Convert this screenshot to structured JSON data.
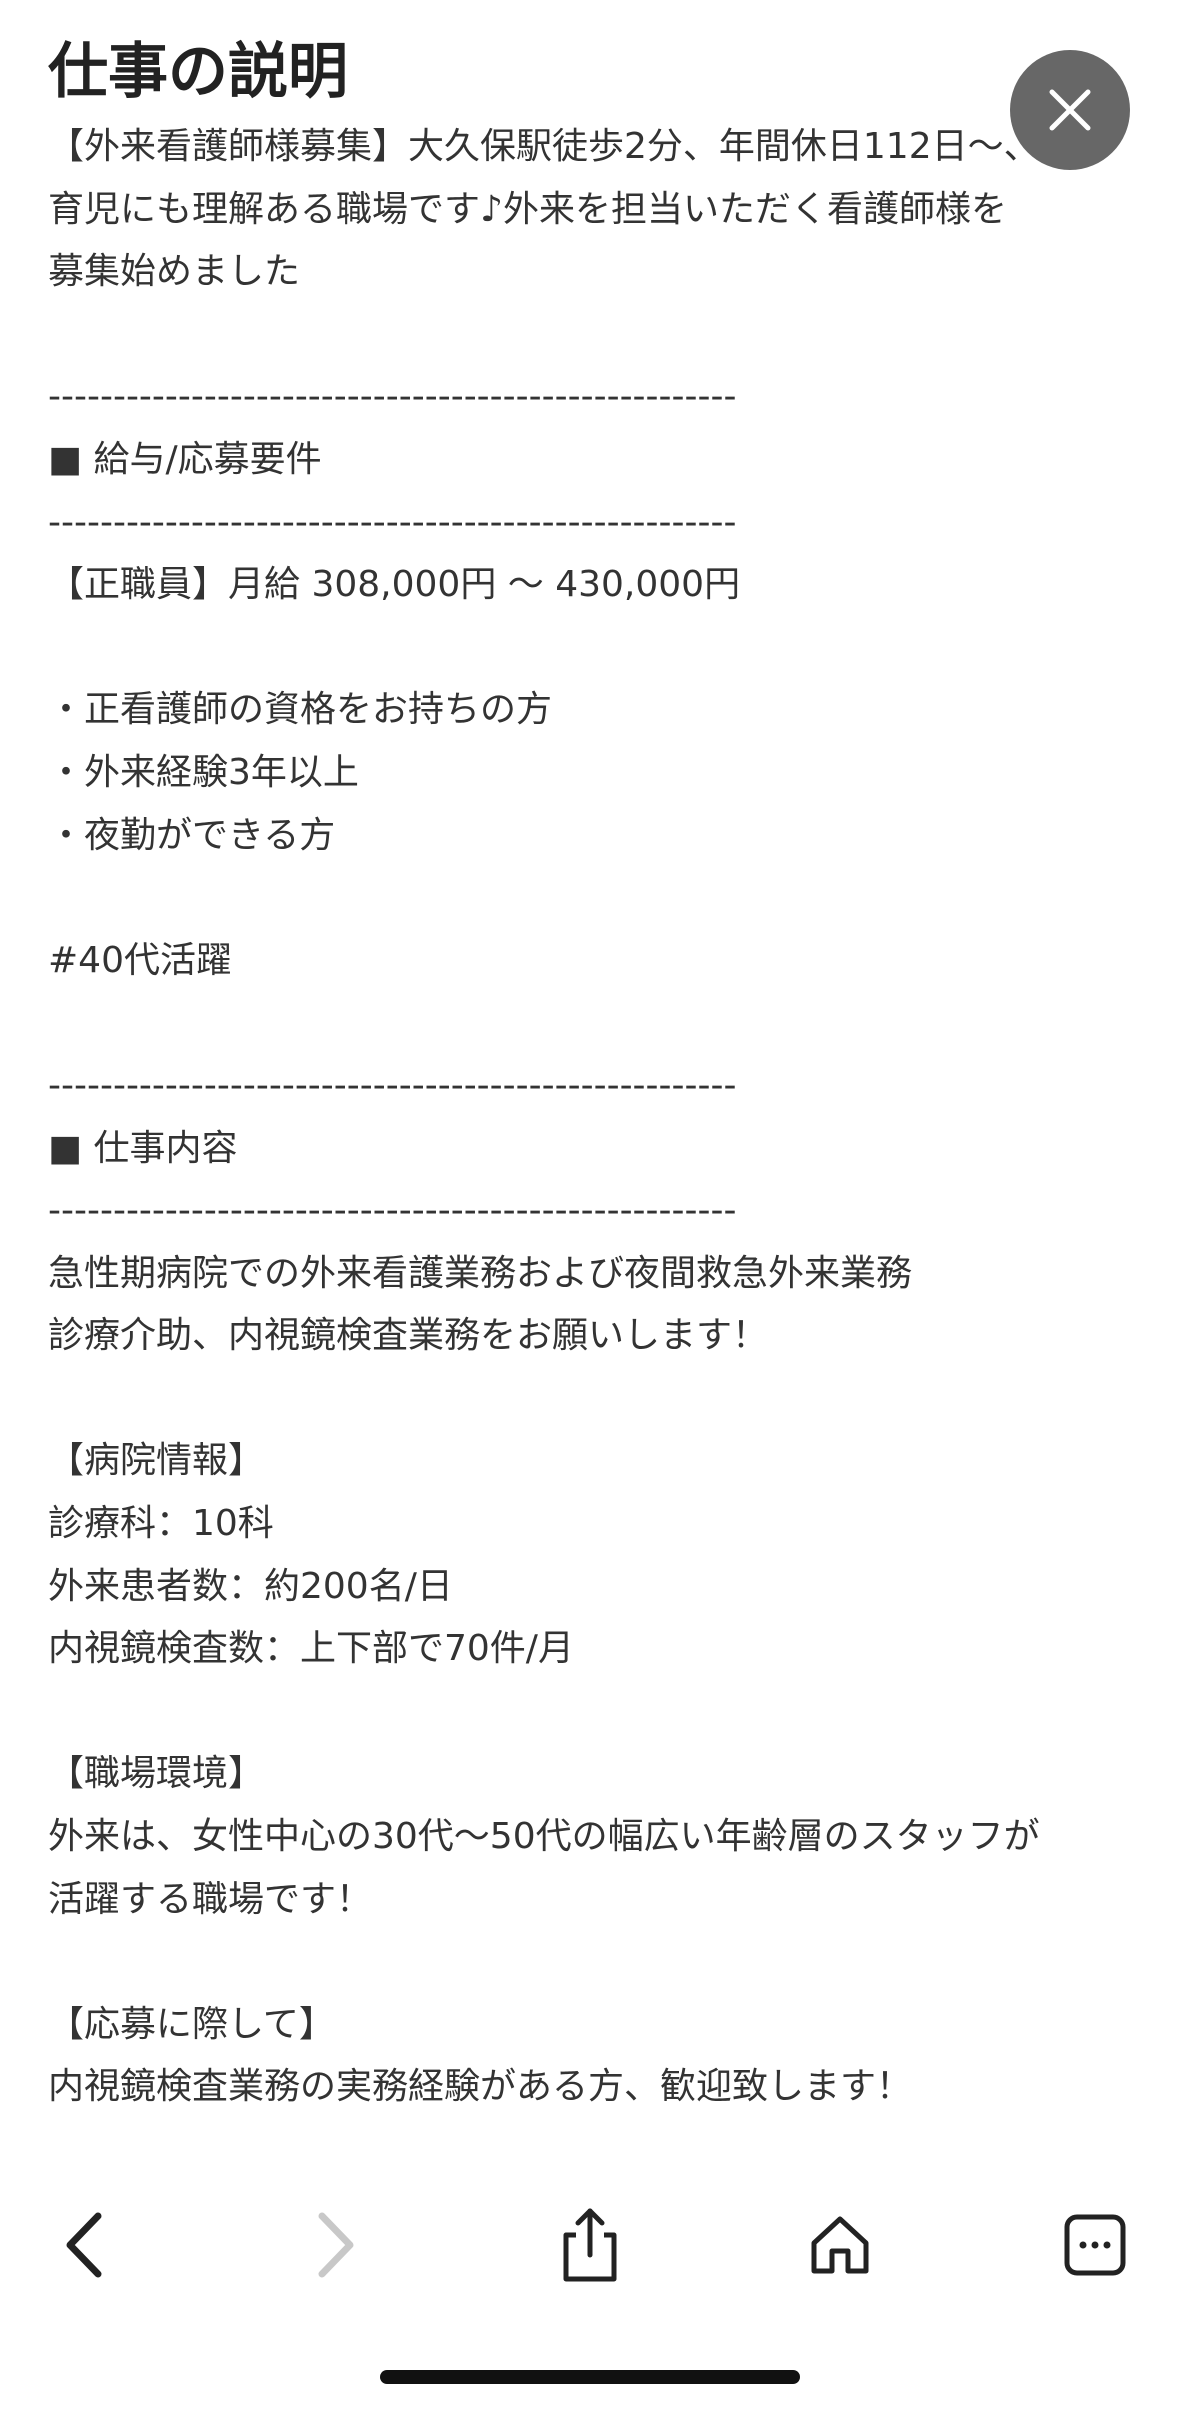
{
  "page": {
    "title": "仕事の説明"
  },
  "description_lines": [
    "【外来看護師様募集】大久保駅徒歩2分、年間休日112日〜、",
    "育児にも理解ある職場です♪外来を担当いただく看護師様を",
    "募集始めました",
    "",
    "-----------------------------------------------------",
    "■ 給与/応募要件",
    "-----------------------------------------------------",
    "【正職員】月給 308,000円 〜 430,000円",
    "",
    "・正看護師の資格をお持ちの方",
    "・外来経験3年以上",
    "・夜勤ができる方",
    "",
    "#40代活躍",
    "",
    "-----------------------------------------------------",
    "■ 仕事内容",
    "-----------------------------------------------------",
    "急性期病院での外来看護業務および夜間救急外来業務",
    "診療介助、内視鏡検査業務をお願いします！",
    "",
    "【病院情報】",
    "診療科：10科",
    "外来患者数：約200名/日",
    "内視鏡検査数：上下部で70件/月",
    "",
    "【職場環境】",
    "外来は、女性中心の30代〜50代の幅広い年齢層のスタッフが",
    "活躍する職場です！",
    "",
    "【応募に際して】",
    "内視鏡検査業務の実務経験がある方、歓迎致します！"
  ],
  "icons": {
    "close": "close-icon",
    "back": "chevron-left-icon",
    "forward": "chevron-right-icon",
    "share": "share-icon",
    "home": "home-icon",
    "more": "more-icon"
  },
  "colors": {
    "text": "#333333",
    "close_bg": "#5a5a5a",
    "toolbar_icon": "#222222",
    "toolbar_icon_disabled": "#c8c8c8"
  }
}
